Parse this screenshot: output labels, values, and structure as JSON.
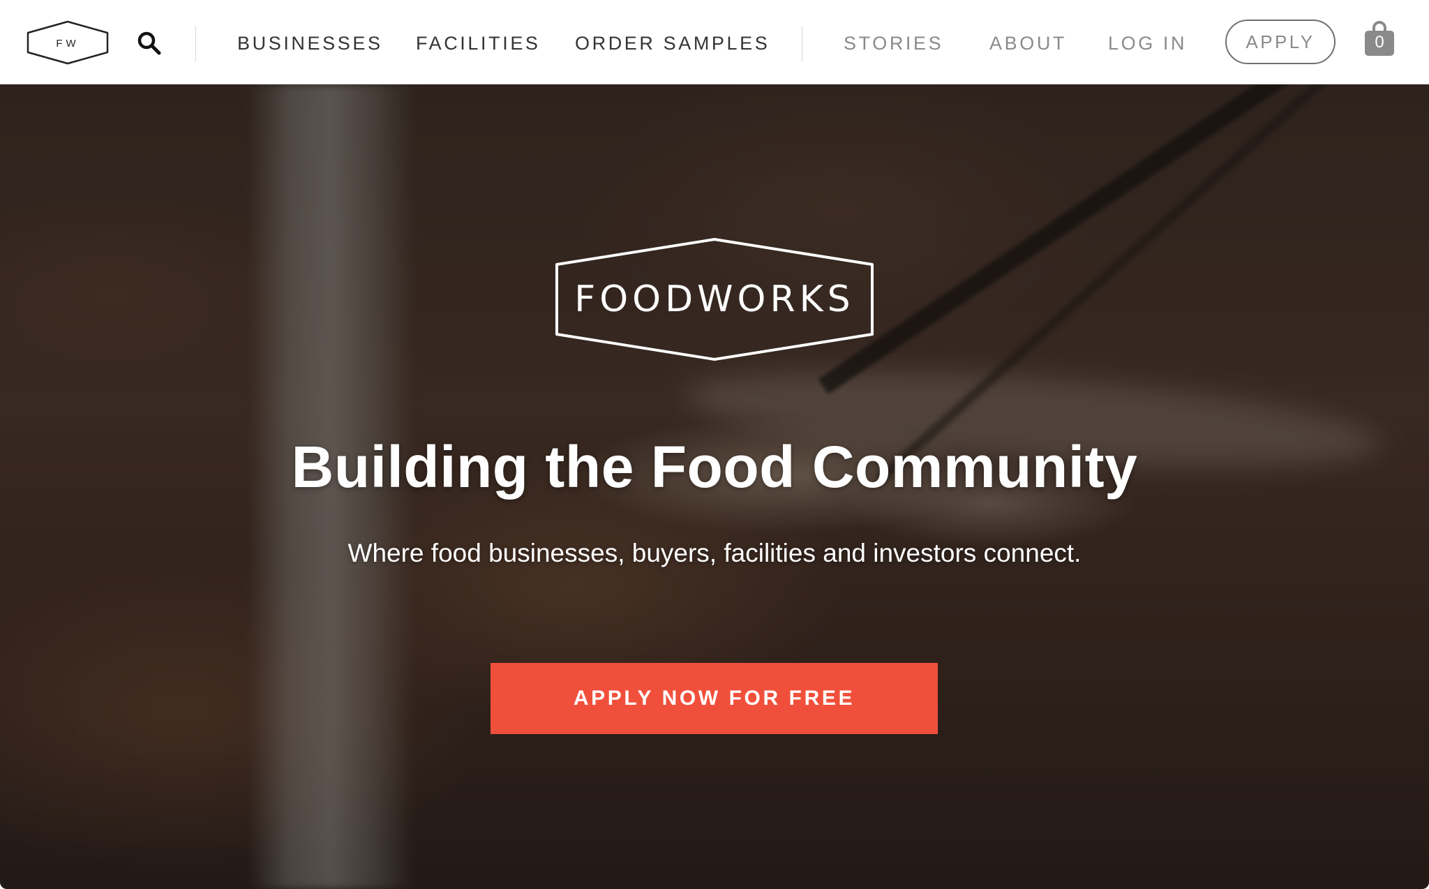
{
  "nav": {
    "logo_text": "FW",
    "primary_links": [
      "BUSINESSES",
      "FACILITIES",
      "ORDER SAMPLES"
    ],
    "secondary_links": [
      "STORIES",
      "ABOUT",
      "LOG IN"
    ],
    "apply_label": "APPLY",
    "cart_count": "0",
    "icons": {
      "search": "search-icon",
      "cart": "shopping-bag-icon"
    }
  },
  "hero": {
    "logo_text": "FOODWORKS",
    "title": "Building the Food Community",
    "subtitle": "Where food businesses, buyers, facilities and investors connect.",
    "cta_label": "APPLY NOW FOR FREE"
  },
  "colors": {
    "accent": "#f0503b",
    "nav_text_primary": "#333333",
    "nav_text_secondary": "#8a8a8a",
    "hero_text": "#ffffff"
  }
}
